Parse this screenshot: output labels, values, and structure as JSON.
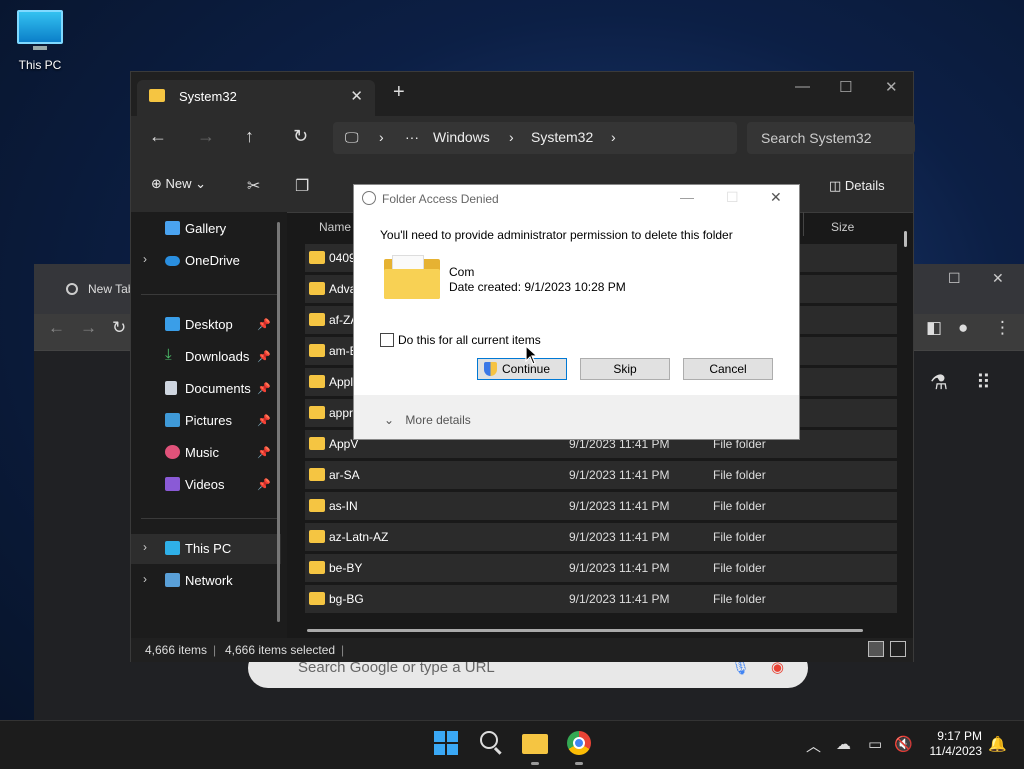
{
  "desktop": {
    "icon_label": "This PC"
  },
  "chrome": {
    "tab_title": "New Tab",
    "omnibox_placeholder": "Search Google or type a URL"
  },
  "explorer": {
    "tab_title": "System32",
    "breadcrumb": [
      "Windows",
      "System32"
    ],
    "breadcrumb_ellipsis": "···",
    "search_placeholder": "Search System32",
    "toolbar": {
      "new_label": "New",
      "details_label": "Details"
    },
    "columns": {
      "name": "Name",
      "size": "Size"
    },
    "nav": {
      "gallery": "Gallery",
      "onedrive": "OneDrive",
      "desktop": "Desktop",
      "downloads": "Downloads",
      "documents": "Documents",
      "pictures": "Pictures",
      "music": "Music",
      "videos": "Videos",
      "this_pc": "This PC",
      "network": "Network"
    },
    "rows": [
      {
        "name": "0409",
        "date": "",
        "type": ""
      },
      {
        "name": "Adva",
        "date": "",
        "type": ""
      },
      {
        "name": "af-ZA",
        "date": "",
        "type": ""
      },
      {
        "name": "am-E",
        "date": "",
        "type": ""
      },
      {
        "name": "Appl",
        "date": "",
        "type": ""
      },
      {
        "name": "appr",
        "date": "",
        "type": ""
      },
      {
        "name": "AppV",
        "date": "9/1/2023 11:41 PM",
        "type": "File folder"
      },
      {
        "name": "ar-SA",
        "date": "9/1/2023 11:41 PM",
        "type": "File folder"
      },
      {
        "name": "as-IN",
        "date": "9/1/2023 11:41 PM",
        "type": "File folder"
      },
      {
        "name": "az-Latn-AZ",
        "date": "9/1/2023 11:41 PM",
        "type": "File folder"
      },
      {
        "name": "be-BY",
        "date": "9/1/2023 11:41 PM",
        "type": "File folder"
      },
      {
        "name": "bg-BG",
        "date": "9/1/2023 11:41 PM",
        "type": "File folder"
      }
    ],
    "status": {
      "items": "4,666 items",
      "selected": "4,666 items selected"
    }
  },
  "dialog": {
    "title": "Folder Access Denied",
    "message": "You'll need to provide administrator permission to delete this folder",
    "folder_name": "Com",
    "date_created": "Date created: 9/1/2023 10:28 PM",
    "checkbox_label": "Do this for all current items",
    "continue_label": "Continue",
    "skip_label": "Skip",
    "cancel_label": "Cancel",
    "more_details_label": "More details"
  },
  "taskbar": {
    "time": "9:17 PM",
    "date": "11/4/2023"
  },
  "icons": {
    "chevron_right": "›",
    "chevron_down": "⌄",
    "close": "✕",
    "plus": "+",
    "back": "←",
    "forward": "→",
    "up": "↑",
    "refresh": "↻"
  }
}
